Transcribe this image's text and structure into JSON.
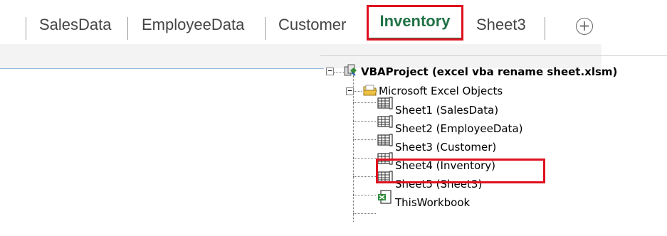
{
  "tabs": [
    {
      "label": "SalesData",
      "active": false
    },
    {
      "label": "EmployeeData",
      "active": false
    },
    {
      "label": "Customer",
      "active": false
    },
    {
      "label": "Inventory",
      "active": true
    },
    {
      "label": "Sheet3",
      "active": false
    }
  ],
  "add_sheet_symbol": "+",
  "tree": {
    "project": {
      "label": "VBAProject (excel vba rename sheet.xlsm)",
      "icon": "vba-project-icon",
      "expanded": true
    },
    "folder": {
      "label": "Microsoft Excel Objects",
      "icon": "folder-icon",
      "expanded": true
    },
    "items": [
      {
        "label": "Sheet1 (SalesData)",
        "icon": "worksheet-icon"
      },
      {
        "label": "Sheet2 (EmployeeData)",
        "icon": "worksheet-icon"
      },
      {
        "label": "Sheet3 (Customer)",
        "icon": "worksheet-icon"
      },
      {
        "label": "Sheet4 (Inventory)",
        "icon": "worksheet-icon"
      },
      {
        "label": "Sheet5 (Sheet3)",
        "icon": "worksheet-icon"
      },
      {
        "label": "ThisWorkbook",
        "icon": "workbook-icon"
      }
    ]
  },
  "colors": {
    "highlight": "#e0101e",
    "active_tab": "#217346"
  }
}
